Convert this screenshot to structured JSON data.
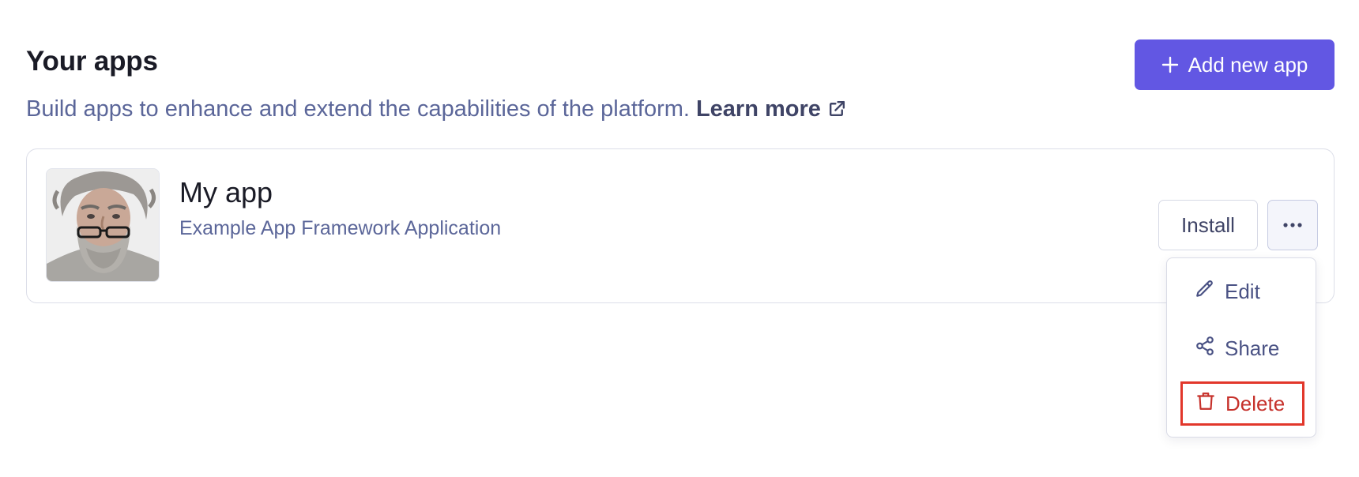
{
  "header": {
    "title": "Your apps",
    "subtitle": "Build apps to enhance and extend the capabilities of the platform.",
    "learn_more": "Learn more",
    "add_button": "Add new app"
  },
  "app": {
    "name": "My app",
    "description": "Example App Framework Application",
    "install_label": "Install"
  },
  "menu": {
    "items": [
      {
        "label": "Edit",
        "icon": "pencil-icon"
      },
      {
        "label": "Share",
        "icon": "share-icon"
      },
      {
        "label": "Delete",
        "icon": "trash-icon"
      }
    ]
  },
  "colors": {
    "accent": "#6257e3",
    "danger": "#c6312b",
    "muted_text": "#5b6699"
  }
}
